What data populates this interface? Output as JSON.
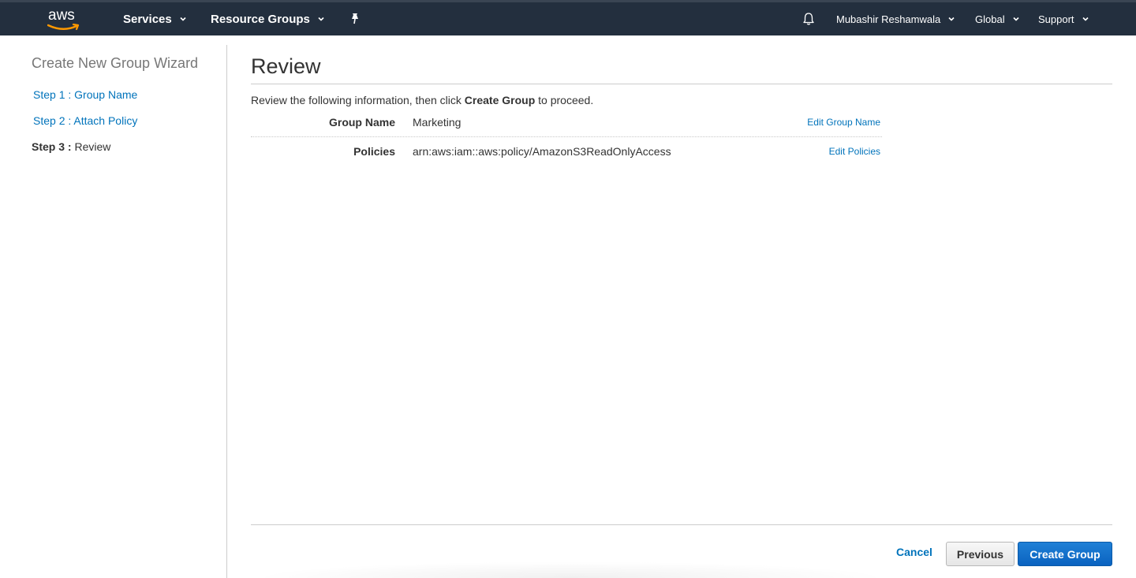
{
  "nav": {
    "logo": "aws",
    "services": "Services",
    "resource_groups": "Resource Groups",
    "user": "Mubashir Reshamwala",
    "region": "Global",
    "support": "Support"
  },
  "sidebar": {
    "title": "Create New Group Wizard",
    "steps": [
      {
        "prefix": "Step 1 :",
        "label": "Group Name"
      },
      {
        "prefix": "Step 2 :",
        "label": "Attach Policy"
      },
      {
        "prefix": "Step 3 :",
        "label": "Review"
      }
    ]
  },
  "main": {
    "title": "Review",
    "intro_before": "Review the following information, then click ",
    "intro_bold": "Create Group",
    "intro_after": " to proceed.",
    "rows": [
      {
        "label": "Group Name",
        "value": "Marketing",
        "edit": "Edit Group Name"
      },
      {
        "label": "Policies",
        "value": "arn:aws:iam::aws:policy/AmazonS3ReadOnlyAccess",
        "edit": "Edit Policies"
      }
    ]
  },
  "footer": {
    "cancel": "Cancel",
    "previous": "Previous",
    "create": "Create Group"
  },
  "colors": {
    "nav_bg": "#232f3e",
    "link": "#0073bb",
    "primary_button": "#0a63c0"
  }
}
